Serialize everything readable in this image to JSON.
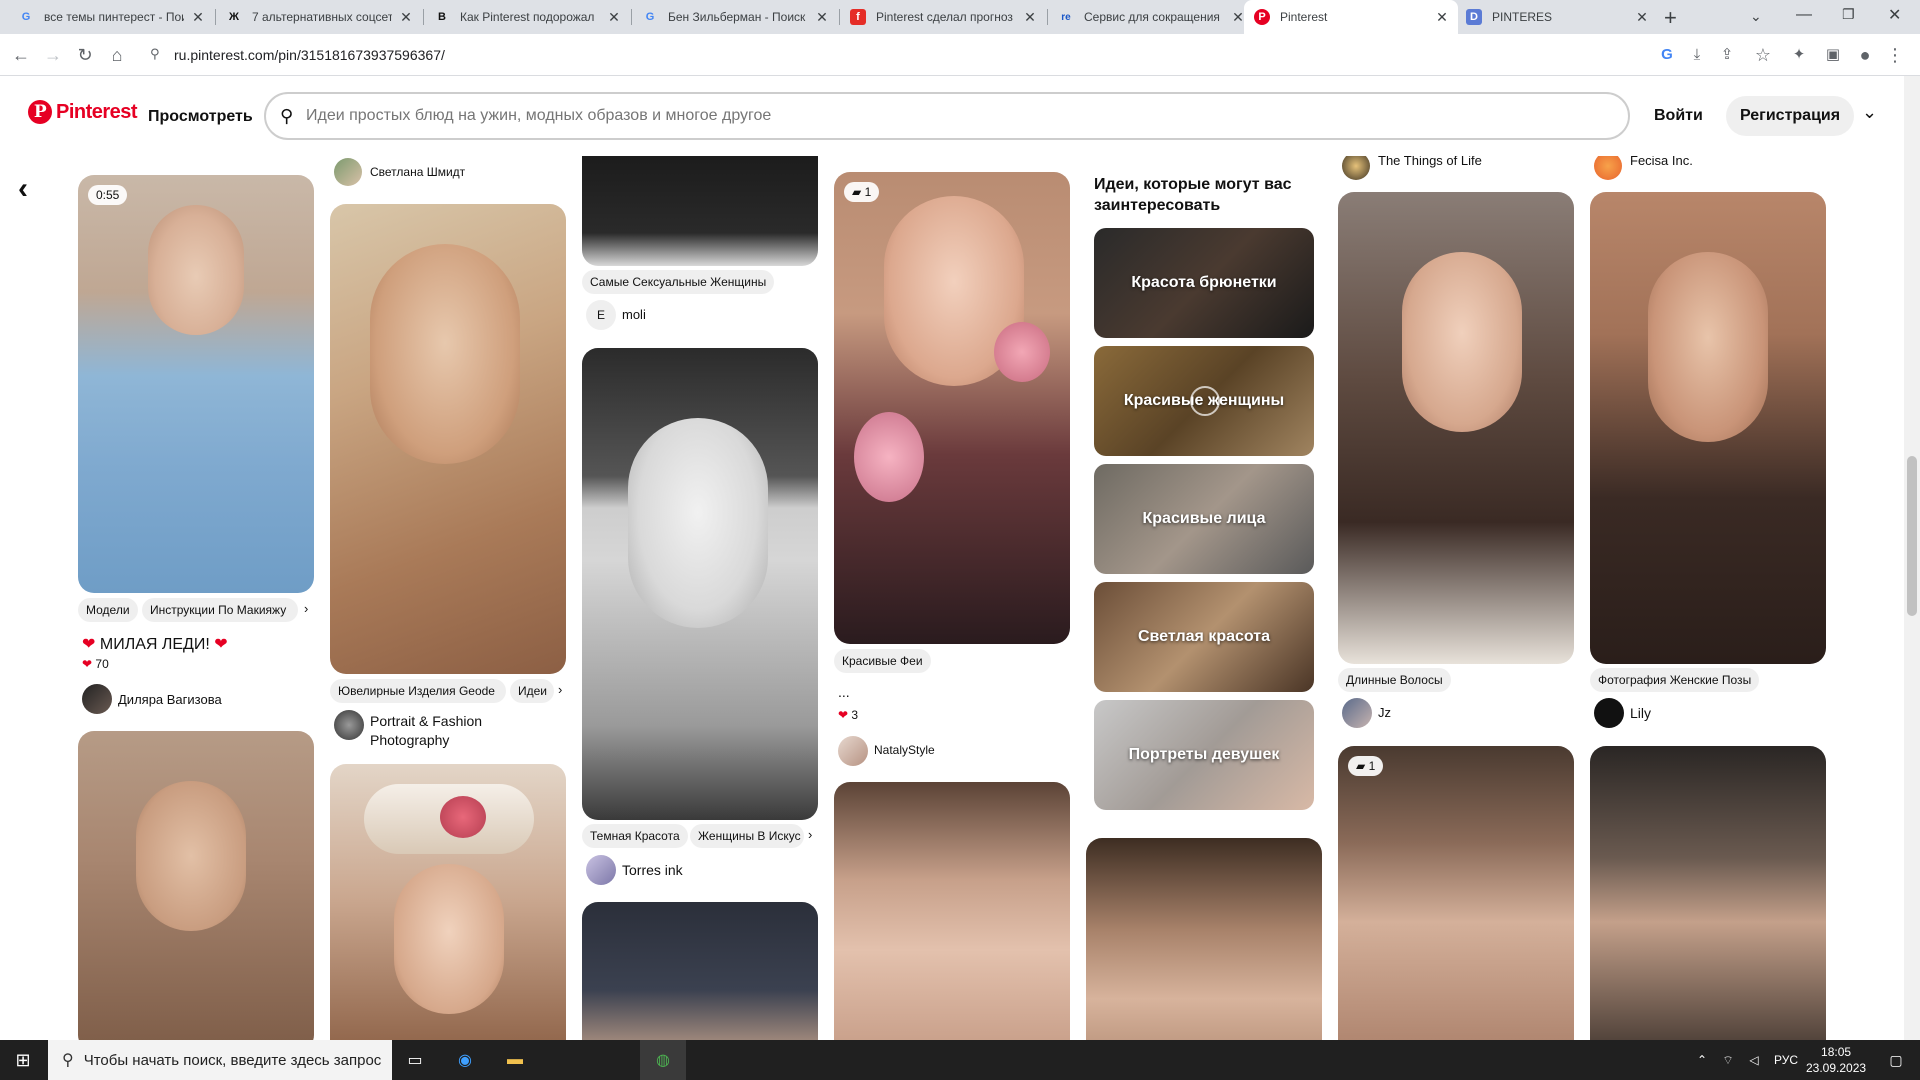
{
  "browser": {
    "tabs": [
      {
        "title": "все темы пинтерест - Пои",
        "favicon": "G"
      },
      {
        "title": "7 альтернативных соцсет",
        "favicon": "Ж"
      },
      {
        "title": "Как Pinterest подорожал",
        "favicon": "B"
      },
      {
        "title": "Бен Зильберман - Поиск",
        "favicon": "G"
      },
      {
        "title": "Pinterest сделал прогноз",
        "favicon": "f"
      },
      {
        "title": "Сервис для сокращения",
        "favicon": "re"
      },
      {
        "title": "Pinterest",
        "favicon": "P"
      },
      {
        "title": "PINTERES",
        "favicon": "D"
      }
    ],
    "url": "ru.pinterest.com/pin/315181673937596367/"
  },
  "header": {
    "logo_text": "Pinterest",
    "explore_label": "Просмотреть",
    "search_placeholder": "Идеи простых блюд на ужин, модных образов и многое другое",
    "login_label": "Войти",
    "signup_label": "Регистрация"
  },
  "pins": {
    "p1": {
      "duration": "0:55",
      "chips": [
        "Модели",
        "Инструкции По Макияжу"
      ],
      "title": "МИЛАЯ ЛЕДИ!",
      "likes": "70",
      "user": "Диляра Вагизова"
    },
    "p2": {
      "chips": [
        "Ювелирные Изделия Geode",
        "Идеи"
      ],
      "user_line1": "Portrait & Fashion",
      "user_line2": "Photography",
      "top_user": "Светлана Шмидт"
    },
    "p3": {
      "chips": [
        "Самые Сексуальные Женщины"
      ],
      "user": "moli",
      "user_initial": "E"
    },
    "p4": {
      "chips": [
        "Темная Красота",
        "Женщины В Искус"
      ],
      "user": "Torres ink"
    },
    "p5": {
      "count": "1",
      "chips": [
        "Красивые Феи"
      ],
      "title": "...",
      "likes": "3",
      "user": "NatalyStyle"
    },
    "p6": {
      "top_user": "The Things of Life",
      "chips": [
        "Длинные Волосы"
      ],
      "user": "Jz"
    },
    "p7": {
      "top_user": "Fecisa Inc.",
      "chips": [
        "Фотография Женские Позы"
      ],
      "user": "Lily"
    },
    "p8": {
      "count": "1"
    }
  },
  "ideas": {
    "title": "Идеи, которые могут вас заинтересовать",
    "items": [
      "Красота брюнетки",
      "Красивые женщины",
      "Красивые лица",
      "Светлая красота",
      "Портреты девушек"
    ]
  },
  "taskbar": {
    "search_placeholder": "Чтобы начать поиск, введите здесь запрос",
    "lang": "РУС",
    "time": "18:05",
    "date": "23.09.2023"
  }
}
